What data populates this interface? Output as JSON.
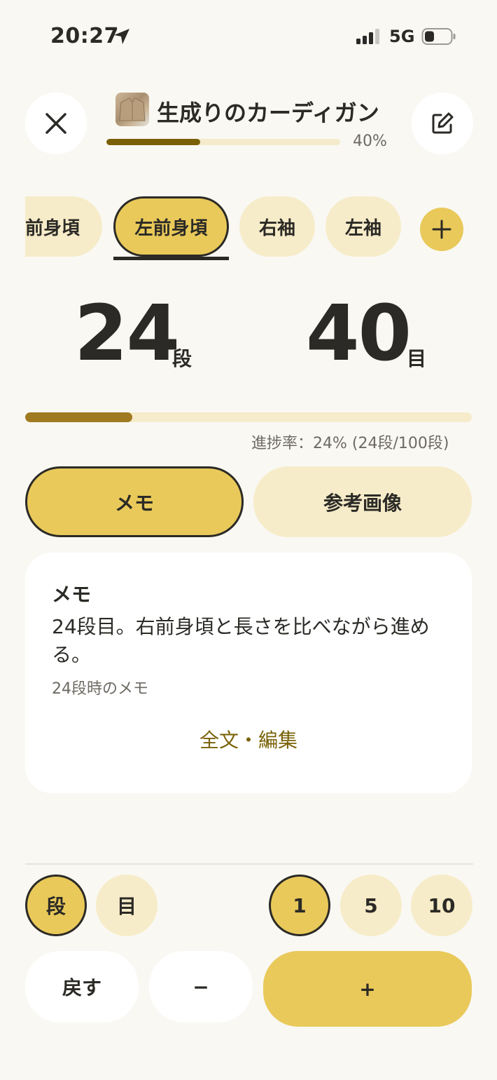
{
  "status_bar": {
    "time": "20:27",
    "network": "5G",
    "icons": [
      "location-arrow-icon",
      "signal-bars-icon",
      "battery-icon"
    ]
  },
  "header": {
    "close_icon": "close-icon",
    "edit_icon": "edit-icon",
    "project_title": "生成りのカーディガン",
    "project_progress_label": "40%",
    "project_progress_fraction": 0.4
  },
  "tabs": {
    "items": [
      {
        "label": "前身頃"
      },
      {
        "label": "左前身頃",
        "active": true
      },
      {
        "label": "右袖"
      },
      {
        "label": "左袖"
      }
    ],
    "add_icon": "plus-icon"
  },
  "counter": {
    "rows_value": "24",
    "rows_unit": "段",
    "stitches_value": "40",
    "stitches_unit": "目",
    "progress_fraction": 0.24,
    "progress_text": "進捗率：24% (24段/100段)"
  },
  "segment": {
    "memo_label": "メモ",
    "reference_label": "参考画像",
    "active": "memo"
  },
  "memo_card": {
    "title": "メモ",
    "body": "24段目。右前身頃と長さを比べながら進める。",
    "subtitle": "24段時のメモ",
    "link_label": "全文・編集"
  },
  "controls": {
    "mode_row": "段",
    "mode_stitch": "目",
    "step_1": "1",
    "step_5": "5",
    "step_10": "10",
    "undo_label": "戻す",
    "minus_label": "−",
    "plus_label": "+"
  },
  "colors": {
    "background": "#f9f8f3",
    "accent": "#e9c95a",
    "accent_light": "#f7ecc9",
    "progress_dark": "#7a5f06",
    "progress_main": "#a07a20",
    "text": "#2b2a26"
  }
}
